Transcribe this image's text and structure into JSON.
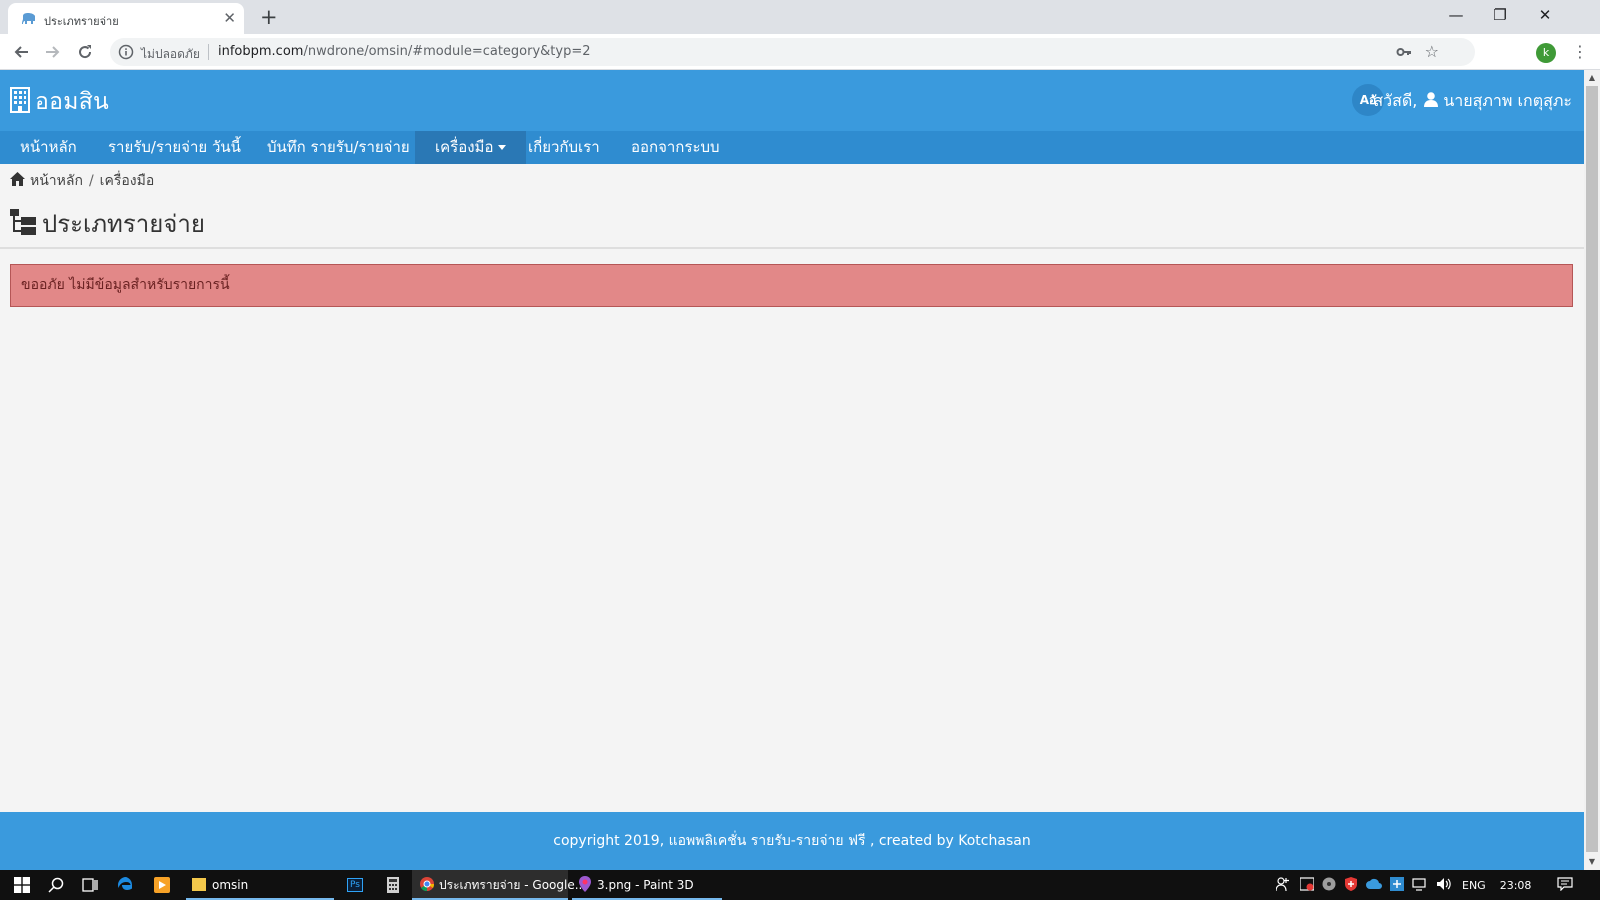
{
  "browser": {
    "tab_title": "ประเภทรายจ่าย",
    "tab_close": "✕",
    "new_tab": "+",
    "window_controls": {
      "minimize": "—",
      "restore": "❐",
      "close": "✕"
    },
    "secure_label": "ไม่ปลอดภัย",
    "url_host": "infobpm.com",
    "url_path": "/nwdrone/omsin/#module=category&typ=2",
    "profile_initial": "k",
    "icons": [
      "back-arrow-icon",
      "forward-arrow-icon",
      "reload-icon",
      "info-icon",
      "key-icon",
      "star-icon",
      "menu-dots-icon"
    ]
  },
  "app": {
    "brand": "ออมสิน",
    "lang_button": "Aอั",
    "greeting": "สวัสดี,",
    "user_name": "นายสุภาพ เกตุสุภะ",
    "nav": [
      {
        "label": "หน้าหลัก"
      },
      {
        "label": "รายรับ/รายจ่าย วันนี้"
      },
      {
        "label": "บันทึก รายรับ/รายจ่าย"
      },
      {
        "label": "เครื่องมือ",
        "active": true,
        "dropdown": true
      },
      {
        "label": "เกี่ยวกับเรา"
      },
      {
        "label": "ออกจากระบบ"
      }
    ],
    "breadcrumb": {
      "home": "หน้าหลัก",
      "separator": "/",
      "current": "เครื่องมือ"
    },
    "page_title": "ประเภทรายจ่าย",
    "alert_message": "ขออภัย ไม่มีข้อมูลสำหรับรายการนี้",
    "footer_text": "copyright 2019, แอพพลิเคชั่น รายรับ-รายจ่าย ฟรี , created by Kotchasan",
    "colors": {
      "header": "#3a9add",
      "navbar": "#2f8cd0",
      "nav_active": "#2a78b5",
      "alert_bg": "#e28888"
    }
  },
  "taskbar": {
    "apps": [
      {
        "label": "omsin"
      },
      {
        "label": "Ps"
      },
      {
        "label": "ประเภทรายจ่าย - Google..."
      },
      {
        "label": "3.png - Paint 3D"
      }
    ],
    "lang": "ENG",
    "time": "23:08"
  }
}
